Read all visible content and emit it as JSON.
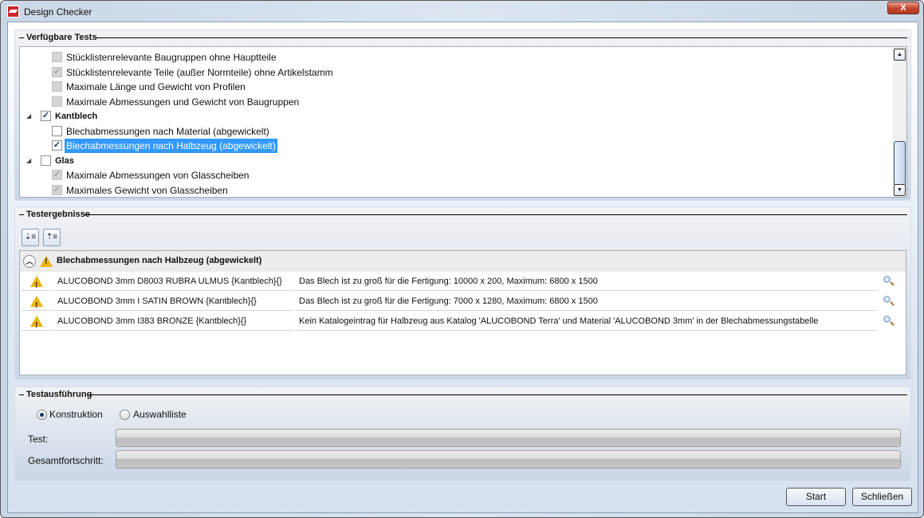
{
  "window": {
    "title": "Design Checker",
    "close_label": "X"
  },
  "available_tests": {
    "title": "Verfügbare Tests",
    "items": [
      {
        "label": "Stücklistenrelevante Baugruppen ohne Hauptteile",
        "level": 1,
        "checked": false,
        "disabled": true
      },
      {
        "label": "Stücklistenrelevante Teile (außer Normteile) ohne Artikelstamm",
        "level": 1,
        "checked": true,
        "disabled": true
      },
      {
        "label": "Maximale Länge und Gewicht von Profilen",
        "level": 1,
        "checked": false,
        "disabled": true
      },
      {
        "label": "Maximale Abmessungen und Gewicht von Baugruppen",
        "level": 1,
        "checked": false,
        "disabled": true
      },
      {
        "label": "Kantblech",
        "level": 0,
        "checked": true,
        "disabled": false
      },
      {
        "label": "Blechabmessungen nach Material (abgewickelt)",
        "level": 1,
        "checked": false,
        "disabled": false
      },
      {
        "label": "Blechabmessungen nach Halbzeug (abgewickelt)",
        "level": 1,
        "checked": true,
        "disabled": false,
        "selected": true
      },
      {
        "label": "Glas",
        "level": 0,
        "checked": false,
        "disabled": false
      },
      {
        "label": "Maximale Abmessungen von Glasscheiben",
        "level": 1,
        "checked": true,
        "disabled": true
      },
      {
        "label": "Maximales Gewicht von Glasscheiben",
        "level": 1,
        "checked": true,
        "disabled": true
      }
    ]
  },
  "results": {
    "title": "Testergebnisse",
    "group_title": "Blechabmessungen nach Halbzeug (abgewickelt)",
    "rows": [
      {
        "object": "ALUCOBOND 3mm D8003 RUBRA ULMUS {Kantblech}{}",
        "message": "Das Blech ist zu groß für die Fertigung: 10000 x 200, Maximum: 6800 x 1500"
      },
      {
        "object": "ALUCOBOND 3mm I SATIN BROWN {Kantblech}{}",
        "message": "Das Blech ist zu groß für die Fertigung: 7000 x 1280, Maximum: 6800 x 1500"
      },
      {
        "object": "ALUCOBOND 3mm I383 BRONZE {Kantblech}{}",
        "message": "Kein Katalogeintrag für Halbzeug aus Katalog 'ALUCOBOND Terra' und Material 'ALUCOBOND 3mm' in der Blechabmessungstabelle"
      }
    ]
  },
  "execution": {
    "title": "Testausführung",
    "radio_construction": "Konstruktion",
    "radio_selection": "Auswahlliste",
    "test_label": "Test:",
    "total_label": "Gesamtfortschritt:",
    "test_progress": 0,
    "total_progress": 0
  },
  "buttons": {
    "start": "Start",
    "close": "Schließen"
  }
}
